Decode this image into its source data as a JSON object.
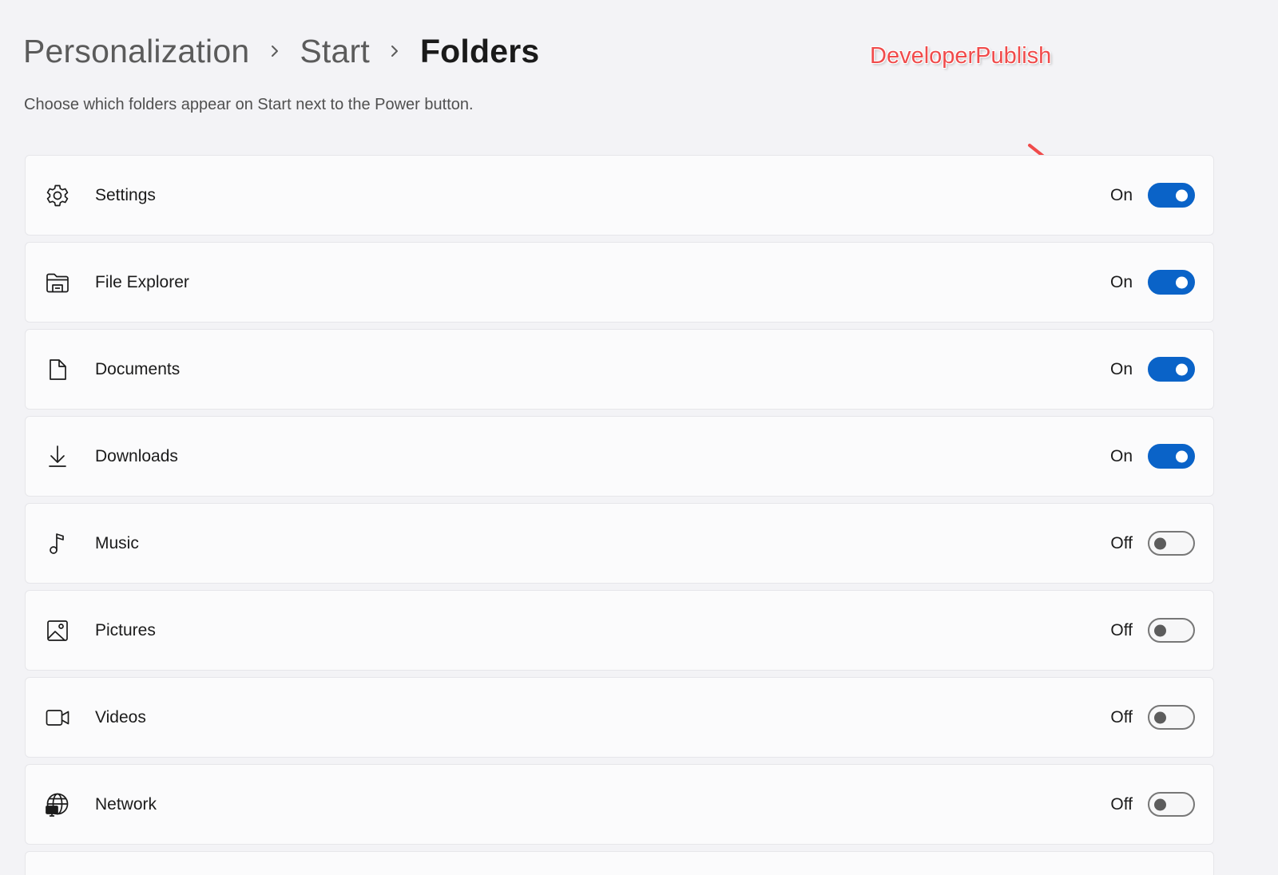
{
  "breadcrumb": {
    "items": [
      "Personalization",
      "Start",
      "Folders"
    ]
  },
  "watermark": "DeveloperPublish",
  "description": "Choose which folders appear on Start next to the Power button.",
  "colors": {
    "accent": "#0a63c8",
    "annotation": "#f04b4b"
  },
  "folders": [
    {
      "label": "Settings",
      "icon": "gear-icon",
      "state_label": "On",
      "on": true
    },
    {
      "label": "File Explorer",
      "icon": "folder-icon",
      "state_label": "On",
      "on": true
    },
    {
      "label": "Documents",
      "icon": "document-icon",
      "state_label": "On",
      "on": true
    },
    {
      "label": "Downloads",
      "icon": "download-icon",
      "state_label": "On",
      "on": true
    },
    {
      "label": "Music",
      "icon": "music-note-icon",
      "state_label": "Off",
      "on": false
    },
    {
      "label": "Pictures",
      "icon": "picture-icon",
      "state_label": "Off",
      "on": false
    },
    {
      "label": "Videos",
      "icon": "video-camera-icon",
      "state_label": "Off",
      "on": false
    },
    {
      "label": "Network",
      "icon": "network-globe-icon",
      "state_label": "Off",
      "on": false
    }
  ]
}
